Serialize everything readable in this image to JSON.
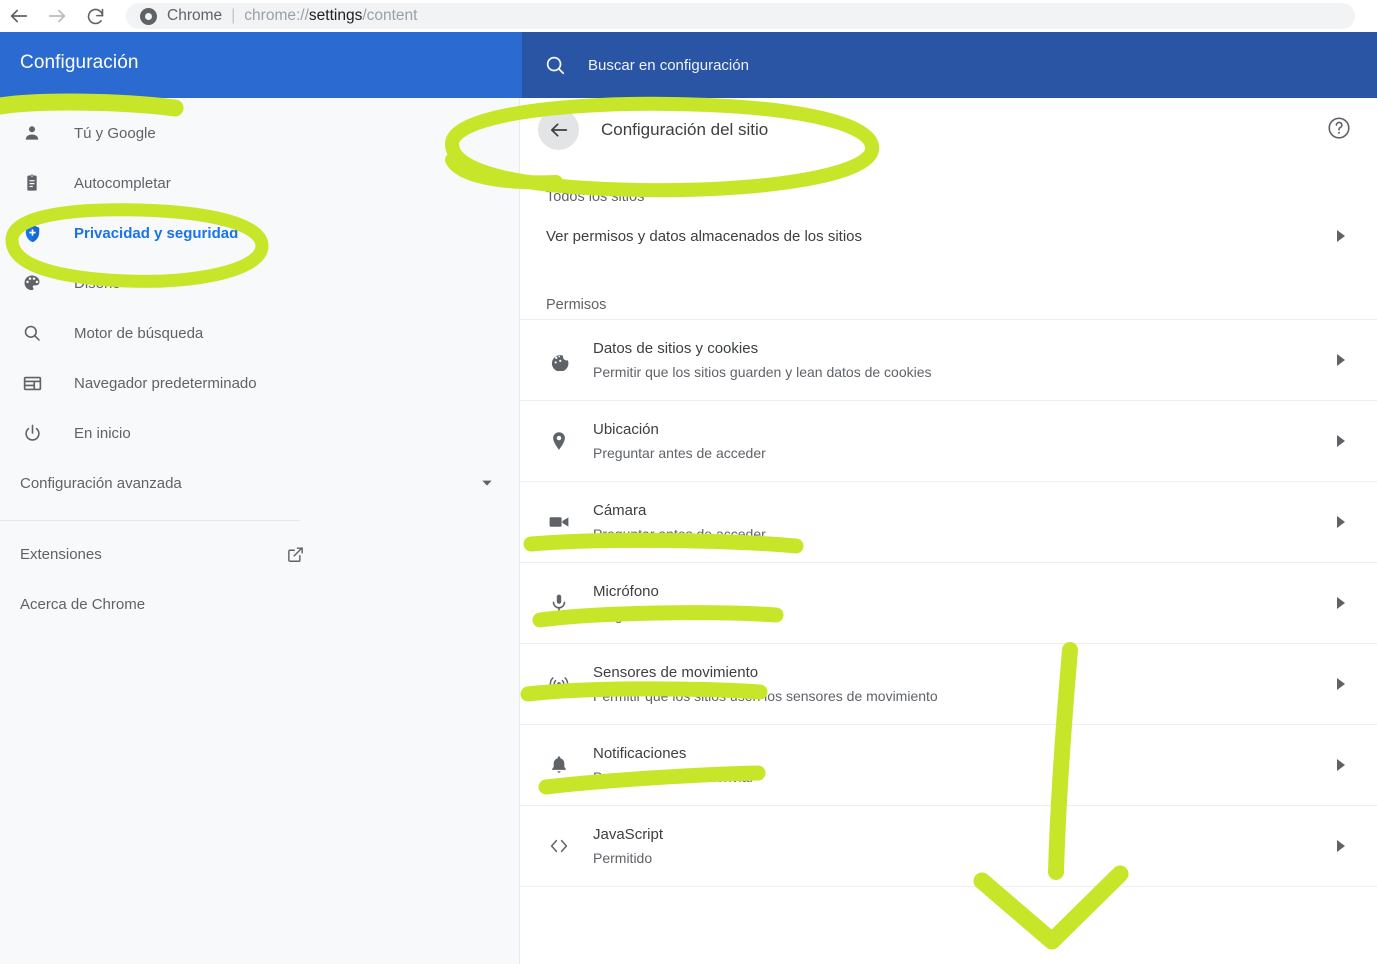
{
  "browser": {
    "back_icon": "back-arrow-icon",
    "forward_icon": "forward-arrow-icon",
    "reload_icon": "reload-icon",
    "brand_icon": "chrome-logo-icon",
    "scheme_label": "Chrome",
    "url_prefix": "chrome://",
    "url_bold": "settings",
    "url_suffix": "/content",
    "url_full": "chrome://settings/content"
  },
  "header": {
    "title": "Configuración",
    "search_placeholder": "Buscar en configuración",
    "search_value": "",
    "search_icon": "search-icon",
    "band_color": "#2b6ad0",
    "search_band_color": "#2a55a5"
  },
  "sidebar": {
    "items": [
      {
        "label": "Tú y Google",
        "icon": "person-icon",
        "active": false
      },
      {
        "label": "Autocompletar",
        "icon": "clipboard-icon",
        "active": false
      },
      {
        "label": "Privacidad y seguridad",
        "icon": "shield-icon",
        "active": true
      },
      {
        "label": "Diseño",
        "icon": "palette-icon",
        "active": false
      },
      {
        "label": "Motor de búsqueda",
        "icon": "search-icon",
        "active": false
      },
      {
        "label": "Navegador predeterminado",
        "icon": "browser-window-icon",
        "active": false
      },
      {
        "label": "En inicio",
        "icon": "power-icon",
        "active": false
      }
    ],
    "advanced": {
      "label": "Configuración avanzada",
      "icon": "chevron-down-icon"
    },
    "footer": [
      {
        "label": "Extensiones",
        "icon": "external-link-icon"
      },
      {
        "label": "Acerca de Chrome",
        "icon": ""
      }
    ],
    "active_color": "#1a73e8"
  },
  "main": {
    "back_icon": "back-arrow-icon",
    "page_title": "Configuración del sitio",
    "help_icon": "help-circle-icon",
    "all_sites_label": "Todos los sitios",
    "view_permissions_row": {
      "label": "Ver permisos y datos almacenados de los sitios",
      "chevron": "chevron-right-icon"
    },
    "permissions_label": "Permisos",
    "permissions": [
      {
        "icon": "cookie-icon",
        "title": "Datos de sitios y cookies",
        "subtitle": "Permitir que los sitios guarden y lean datos de cookies",
        "chevron": "chevron-right-icon"
      },
      {
        "icon": "location-pin-icon",
        "title": "Ubicación",
        "subtitle": "Preguntar antes de acceder",
        "chevron": "chevron-right-icon"
      },
      {
        "icon": "video-camera-icon",
        "title": "Cámara",
        "subtitle": "Preguntar antes de acceder",
        "chevron": "chevron-right-icon"
      },
      {
        "icon": "microphone-icon",
        "title": "Micrófono",
        "subtitle": "Preguntar antes de acceder",
        "chevron": "chevron-right-icon"
      },
      {
        "icon": "motion-sensor-icon",
        "title": "Sensores de movimiento",
        "subtitle": "Permitir que los sitios usen los sensores de movimiento",
        "chevron": "chevron-right-icon"
      },
      {
        "icon": "bell-icon",
        "title": "Notificaciones",
        "subtitle": "Preguntar antes de enviar",
        "chevron": "chevron-right-icon"
      },
      {
        "icon": "code-brackets-icon",
        "title": "JavaScript",
        "subtitle": "Permitido",
        "chevron": "chevron-right-icon"
      }
    ]
  },
  "annotations": {
    "color": "#c8e629",
    "marks": [
      {
        "name": "highlight-stroke-under-settings-title",
        "type": "stroke"
      },
      {
        "name": "highlight-ellipse-privacy-security",
        "type": "ellipse"
      },
      {
        "name": "highlight-ellipse-site-settings-title",
        "type": "ellipse"
      },
      {
        "name": "highlight-stroke-under-location",
        "type": "stroke"
      },
      {
        "name": "highlight-stroke-under-camera",
        "type": "stroke"
      },
      {
        "name": "highlight-stroke-under-microphone",
        "type": "stroke"
      },
      {
        "name": "highlight-stroke-under-motion-sensors",
        "type": "stroke"
      },
      {
        "name": "highlight-down-arrow",
        "type": "arrow"
      }
    ]
  }
}
